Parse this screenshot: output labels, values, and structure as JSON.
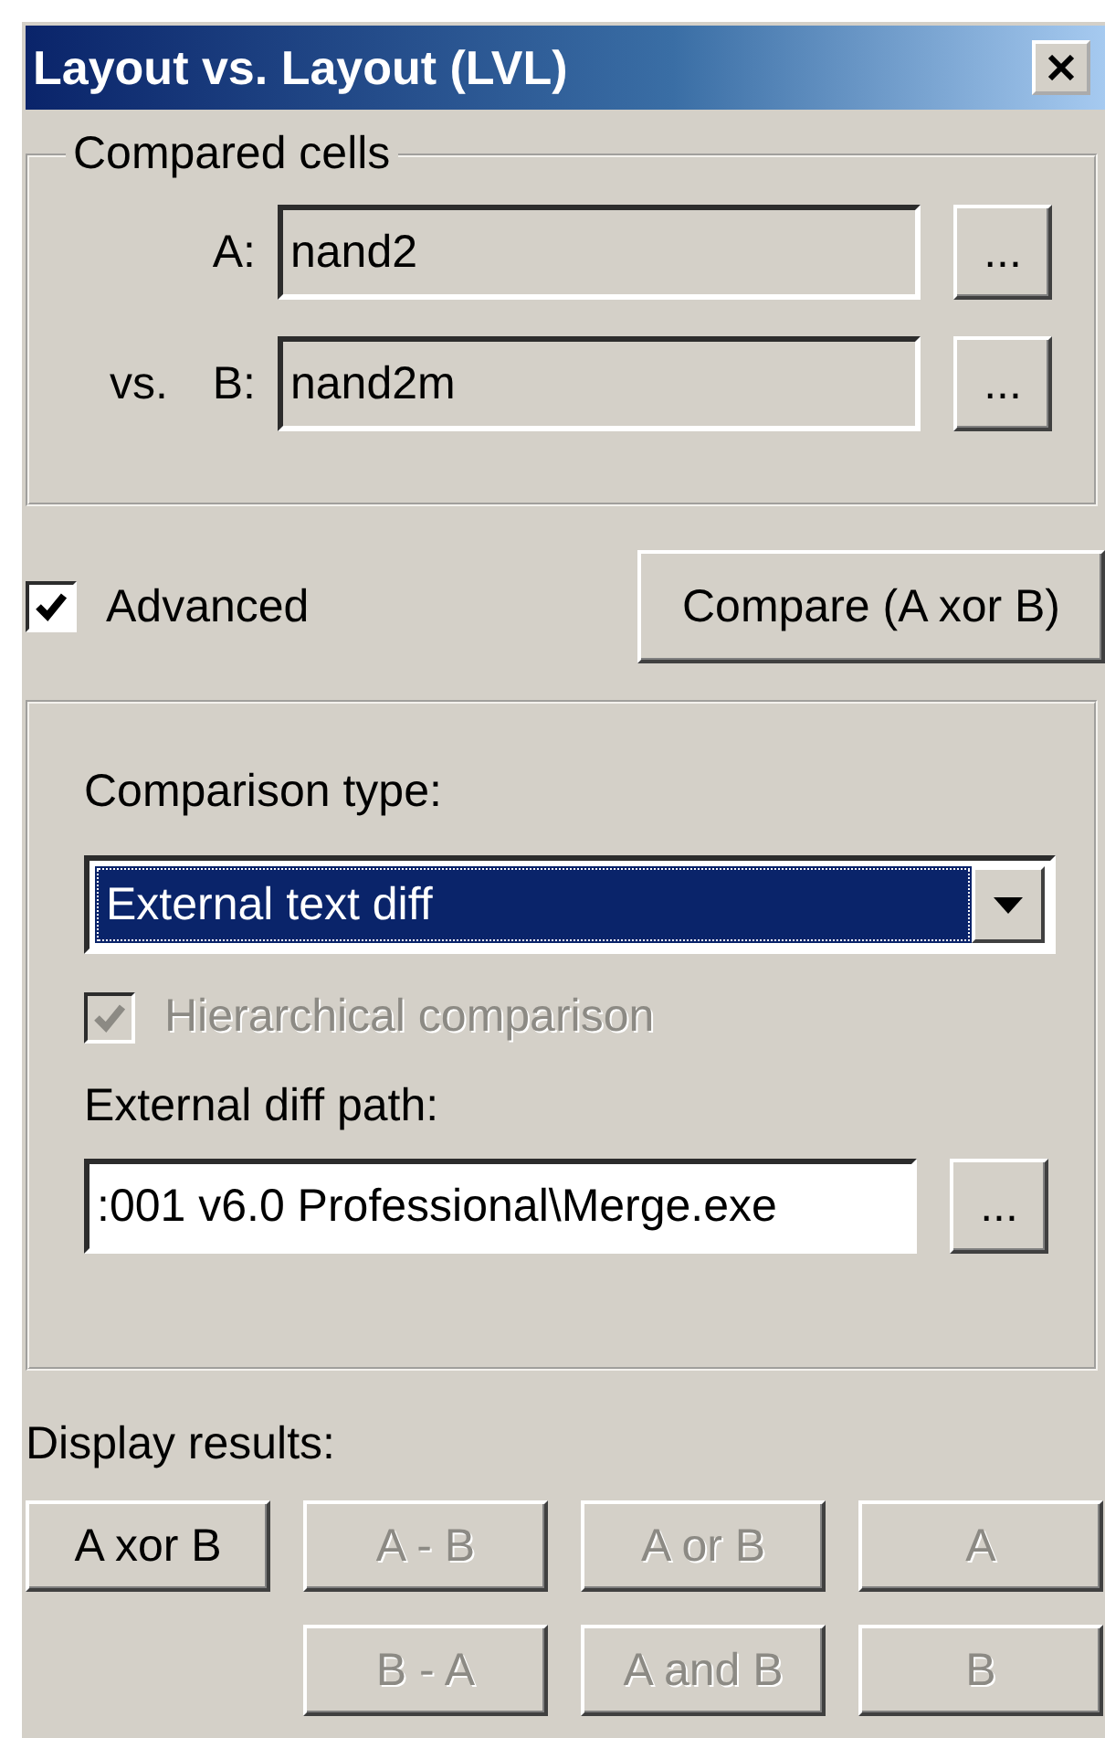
{
  "window": {
    "title": "Layout vs. Layout (LVL)"
  },
  "compared_cells": {
    "title": "Compared cells",
    "fields": [
      {
        "label": "A:",
        "value": "nand2",
        "browse": "..."
      },
      {
        "prefix": "vs.",
        "label": "B:",
        "value": "nand2m",
        "browse": "..."
      }
    ]
  },
  "advanced": {
    "label": "Advanced",
    "checked": true
  },
  "compare_button": "Compare (A xor B)",
  "comparison_type": {
    "label": "Comparison type:",
    "value": "External text diff"
  },
  "hierarchical": {
    "label": "Hierarchical comparison",
    "checked": true,
    "disabled": true
  },
  "external_diff": {
    "label": "External diff path:",
    "value": ":001 v6.0 Professional\\Merge.exe",
    "browse": "..."
  },
  "display_results": {
    "label": "Display results:",
    "buttons": [
      {
        "label": "A xor B",
        "disabled": false
      },
      {
        "label": "A - B",
        "disabled": true
      },
      {
        "label": "A or B",
        "disabled": true
      },
      {
        "label": "A",
        "disabled": true
      },
      {
        "label": "B - A",
        "disabled": true
      },
      {
        "label": "A and B",
        "disabled": true
      },
      {
        "label": "B",
        "disabled": true
      }
    ]
  }
}
